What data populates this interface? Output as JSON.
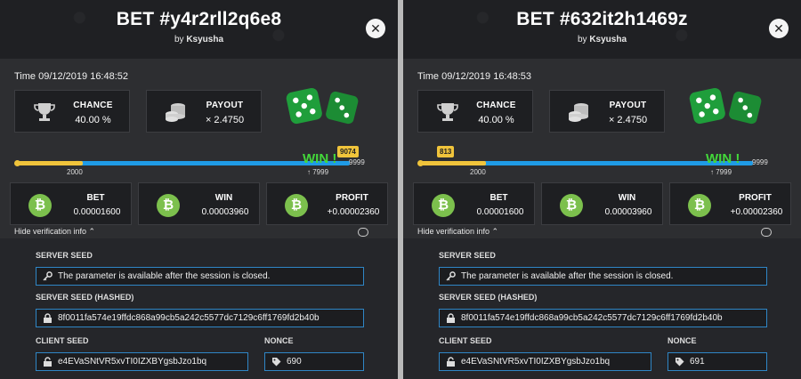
{
  "panels": [
    {
      "title": "BET #y4r2rll2q6e8",
      "by_prefix": "by",
      "author": "Ksyusha",
      "time": "Time 09/12/2019 16:48:52",
      "chance_label": "CHANCE",
      "chance_value": "40.00 %",
      "payout_label": "PAYOUT",
      "payout_value": "× 2.4750",
      "roll": "9074",
      "roll_fraction": 0.9074,
      "range_low": "2000",
      "range_high": "↑ 7999",
      "max_value": "9999",
      "win_text": "WIN !",
      "bet_label": "BET",
      "bet_value": "0.00001600",
      "win_label": "WIN",
      "win_value": "0.00003960",
      "profit_label": "PROFIT",
      "profit_value": "+0.00002360",
      "hide_verification": "Hide verification info ⌃",
      "server_seed_label": "SERVER SEED",
      "server_seed_value": "The parameter is available after the session is closed.",
      "server_seed_hashed_label": "SERVER SEED (HASHED)",
      "server_seed_hashed_value": "8f0011fa574e19ffdc868a99cb5a242c5577dc7129c6ff1769fd2b40b",
      "client_seed_label": "CLIENT SEED",
      "client_seed_value": "e4EVaSNtVR5xvTI0IZXBYgsbJzo1bq",
      "nonce_label": "NONCE",
      "nonce_value": "690"
    },
    {
      "title": "BET #632it2h1469z",
      "by_prefix": "by",
      "author": "Ksyusha",
      "time": "Time 09/12/2019 16:48:53",
      "chance_label": "CHANCE",
      "chance_value": "40.00 %",
      "payout_label": "PAYOUT",
      "payout_value": "× 2.4750",
      "roll": "813",
      "roll_fraction": 0.0813,
      "range_low": "2000",
      "range_high": "↑ 7999",
      "max_value": "9999",
      "win_text": "WIN !",
      "bet_label": "BET",
      "bet_value": "0.00001600",
      "win_label": "WIN",
      "win_value": "0.00003960",
      "profit_label": "PROFIT",
      "profit_value": "+0.00002360",
      "hide_verification": "Hide verification info ⌃",
      "server_seed_label": "SERVER SEED",
      "server_seed_value": "The parameter is available after the session is closed.",
      "server_seed_hashed_label": "SERVER SEED (HASHED)",
      "server_seed_hashed_value": "8f0011fa574e19ffdc868a99cb5a242c5577dc7129c6ff1769fd2b40b",
      "client_seed_label": "CLIENT SEED",
      "client_seed_value": "e4EVaSNtVR5xvTI0IZXBYgsbJzo1bq",
      "nonce_label": "NONCE",
      "nonce_value": "691"
    }
  ],
  "colors": {
    "panel_bg": "#2d2e31",
    "win_green": "#43d83a",
    "roll_yellow": "#f0c43b",
    "bar_blue": "#1f9be6",
    "coin_green": "#7cc04d",
    "field_border": "#2f86c6"
  },
  "icons": [
    "close-icon",
    "trophy-icon",
    "coins-icon",
    "dice-icon",
    "bitcoin-icon",
    "chat-icon",
    "key-icon",
    "lock-icon",
    "unlock-icon",
    "tag-icon"
  ]
}
